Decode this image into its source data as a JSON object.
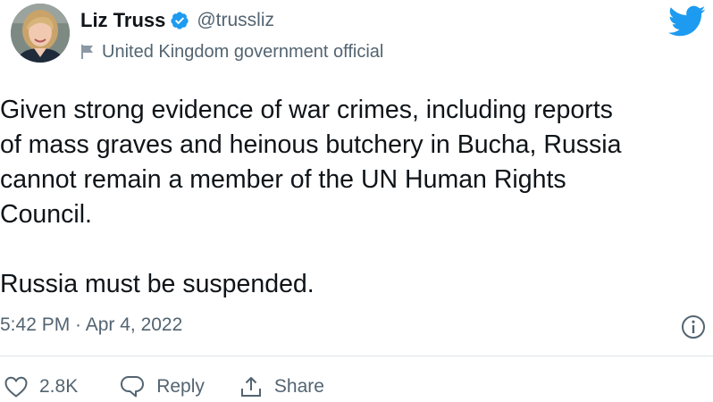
{
  "author": {
    "display_name": "Liz Truss",
    "handle": "@trussliz",
    "label": "United Kingdom government official",
    "verified": true
  },
  "tweet": {
    "text": "Given strong evidence of war crimes, including reports\nof mass graves and heinous butchery in Bucha, Russia\ncannot remain a member of the UN Human Rights\nCouncil.\n\nRussia must be suspended.",
    "timestamp": "5:42 PM · Apr 4, 2022"
  },
  "actions": {
    "like_count": "2.8K",
    "reply_label": "Reply",
    "share_label": "Share"
  },
  "icons": {
    "logo": "twitter-bird-icon",
    "verified": "verified-badge-icon",
    "label": "flag-icon",
    "info": "info-icon",
    "like": "heart-icon",
    "reply": "speech-bubble-icon",
    "share": "share-icon"
  },
  "colors": {
    "twitter_blue": "#1d9bf0",
    "text_primary": "#0f1419",
    "text_secondary": "#536471"
  }
}
